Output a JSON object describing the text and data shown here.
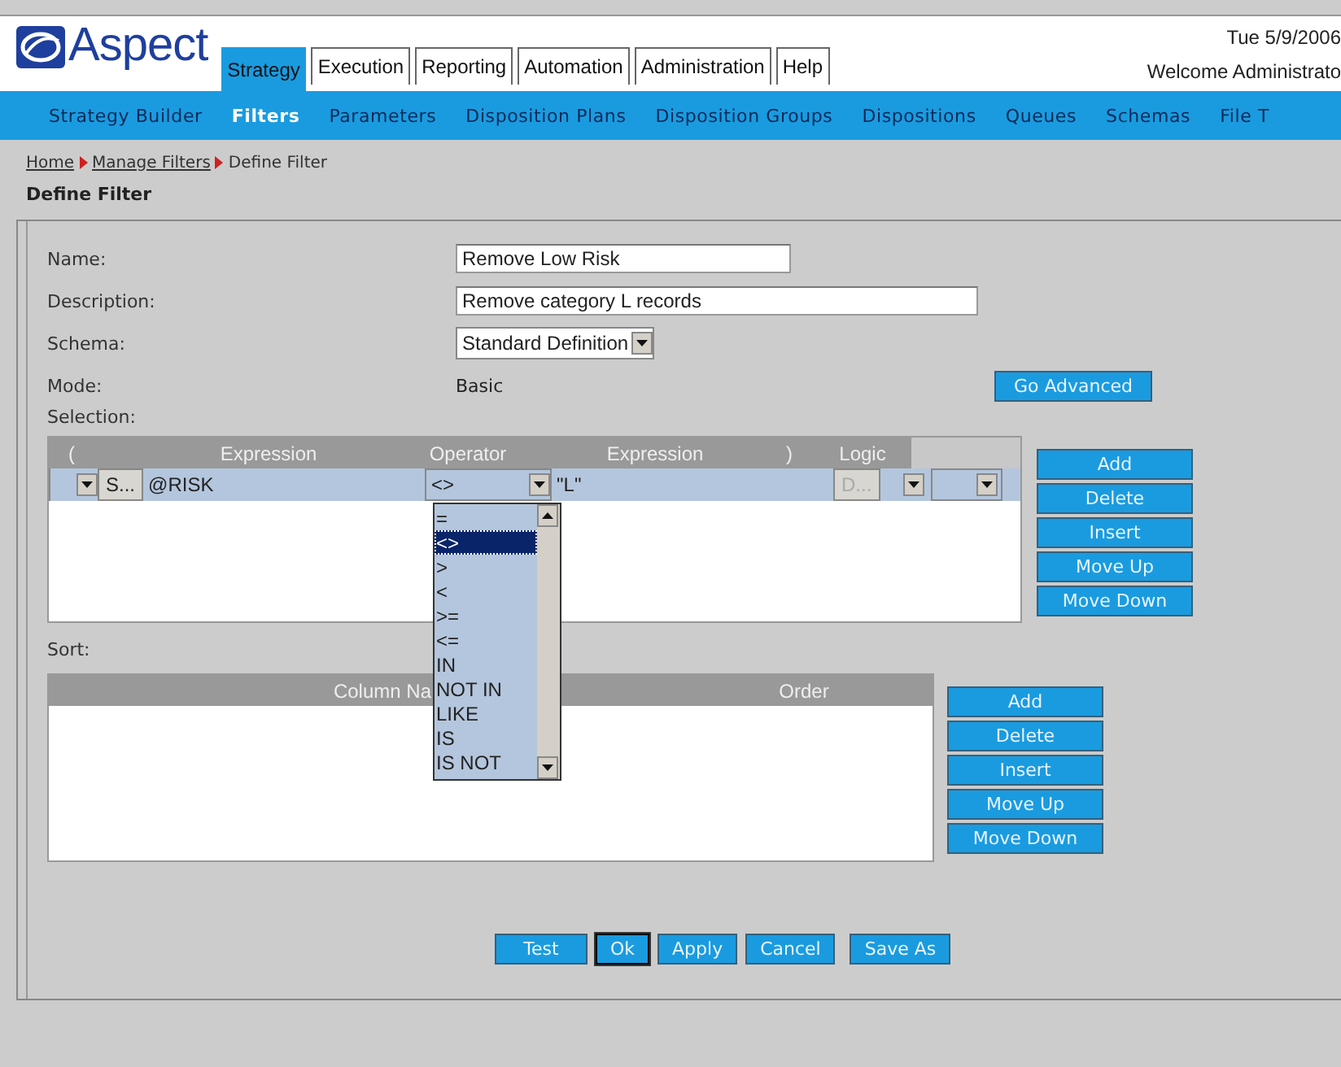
{
  "logo": {
    "text": "Aspect"
  },
  "tabs": [
    {
      "label": "Strategy",
      "selected": true
    },
    {
      "label": "Execution",
      "selected": false
    },
    {
      "label": "Reporting",
      "selected": false
    },
    {
      "label": "Automation",
      "selected": false
    },
    {
      "label": "Administration",
      "selected": false
    },
    {
      "label": "Help",
      "selected": false
    }
  ],
  "header_info": {
    "date": "Tue 5/9/2006",
    "welcome": "Welcome Administrato"
  },
  "nav": [
    {
      "label": "Strategy Builder",
      "selected": false
    },
    {
      "label": "Filters",
      "selected": true
    },
    {
      "label": "Parameters",
      "selected": false
    },
    {
      "label": "Disposition Plans",
      "selected": false
    },
    {
      "label": "Disposition Groups",
      "selected": false
    },
    {
      "label": "Dispositions",
      "selected": false
    },
    {
      "label": "Queues",
      "selected": false
    },
    {
      "label": "Schemas",
      "selected": false
    },
    {
      "label": "File T",
      "selected": false
    }
  ],
  "breadcrumb": {
    "links": [
      "Home",
      "Manage Filters"
    ],
    "current": "Define Filter"
  },
  "page_title": "Define Filter",
  "form": {
    "name": {
      "label": "Name:",
      "value": "Remove Low Risk"
    },
    "description": {
      "label": "Description:",
      "value": "Remove category L records"
    },
    "schema": {
      "label": "Schema:",
      "value": "Standard Definition"
    },
    "mode": {
      "label": "Mode:",
      "value": "Basic",
      "button": "Go Advanced"
    }
  },
  "selection": {
    "label": "Selection:",
    "columns": [
      "(",
      "Expression",
      "Operator",
      "Expression",
      ")",
      "Logic"
    ],
    "row": {
      "select_button": "S...",
      "left_expression": "@RISK",
      "operator": "<>",
      "right_expression": "\"L\"",
      "disabled_button": "D..."
    },
    "operator_options": [
      {
        "label": "=",
        "selected": false
      },
      {
        "label": "<>",
        "selected": true
      },
      {
        "label": ">",
        "selected": false
      },
      {
        "label": "<",
        "selected": false
      },
      {
        "label": ">=",
        "selected": false
      },
      {
        "label": "<=",
        "selected": false
      },
      {
        "label": "IN",
        "selected": false
      },
      {
        "label": "NOT IN",
        "selected": false
      },
      {
        "label": "LIKE",
        "selected": false
      },
      {
        "label": "IS",
        "selected": false
      },
      {
        "label": "IS NOT",
        "selected": false
      }
    ],
    "buttons": [
      "Add",
      "Delete",
      "Insert",
      "Move Up",
      "Move Down"
    ]
  },
  "sort": {
    "label": "Sort:",
    "columns": [
      "Column Na",
      "Order"
    ],
    "buttons": [
      "Add",
      "Delete",
      "Insert",
      "Move Up",
      "Move Down"
    ]
  },
  "footer_buttons": [
    {
      "label": "Test",
      "focused": false
    },
    {
      "label": "Ok",
      "focused": true
    },
    {
      "label": "Apply",
      "focused": false
    },
    {
      "label": "Cancel",
      "focused": false
    },
    {
      "label": "Save As",
      "focused": false
    }
  ]
}
